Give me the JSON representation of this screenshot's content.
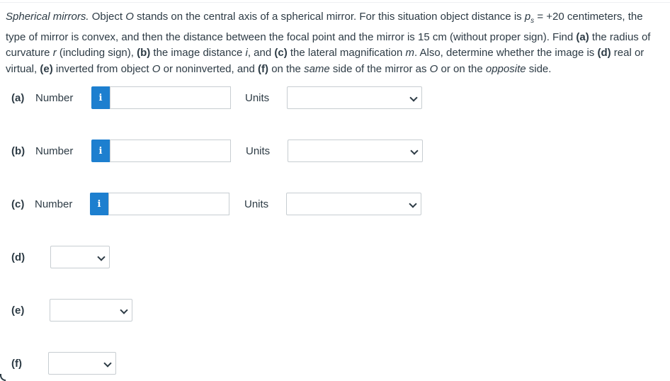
{
  "problem": {
    "lead_title": "Spherical mirrors.",
    "s1": " Object ",
    "obj1": "O",
    "s2": " stands on the central axis of a spherical mirror. For this situation object distance is ",
    "ps_p": "p",
    "ps_sub": "s",
    "s3": " = +20 centimeters, the type of mirror is convex, and then the distance between the focal point and the mirror is 15 cm (without proper sign). Find ",
    "a": "(a)",
    "s4": " the radius of curvature ",
    "r": "r",
    "s5": " (including sign), ",
    "b": "(b)",
    "s6": " the image distance ",
    "i": "i",
    "s7": ", and ",
    "c": "(c)",
    "s8": " the lateral magnification ",
    "m": "m",
    "s9": ". Also, determine whether the image is ",
    "d": "(d)",
    "s10": " real or virtual, ",
    "e": "(e)",
    "s11": " inverted from object ",
    "obj2": "O",
    "s12": " or noninverted, and ",
    "f": "(f)",
    "s13": " on the ",
    "same": "same",
    "s14": " side of the mirror as ",
    "obj3": "O",
    "s15": " or on the ",
    "opposite": "opposite",
    "s16": " side."
  },
  "parts": {
    "a": {
      "label": "(a)",
      "number_label": "Number",
      "info_icon": "i",
      "value": "",
      "units_label": "Units",
      "units_value": ""
    },
    "b": {
      "label": "(b)",
      "number_label": "Number",
      "info_icon": "i",
      "value": "",
      "units_label": "Units",
      "units_value": ""
    },
    "c": {
      "label": "(c)",
      "number_label": "Number",
      "info_icon": "i",
      "value": "",
      "units_label": "Units",
      "units_value": ""
    },
    "d": {
      "label": "(d)",
      "value": ""
    },
    "e": {
      "label": "(e)",
      "value": ""
    },
    "f": {
      "label": "(f)",
      "value": ""
    }
  },
  "colors": {
    "info_button": "#1d7fcf",
    "text": "#2d3b45",
    "border": "#c7cdd1"
  }
}
